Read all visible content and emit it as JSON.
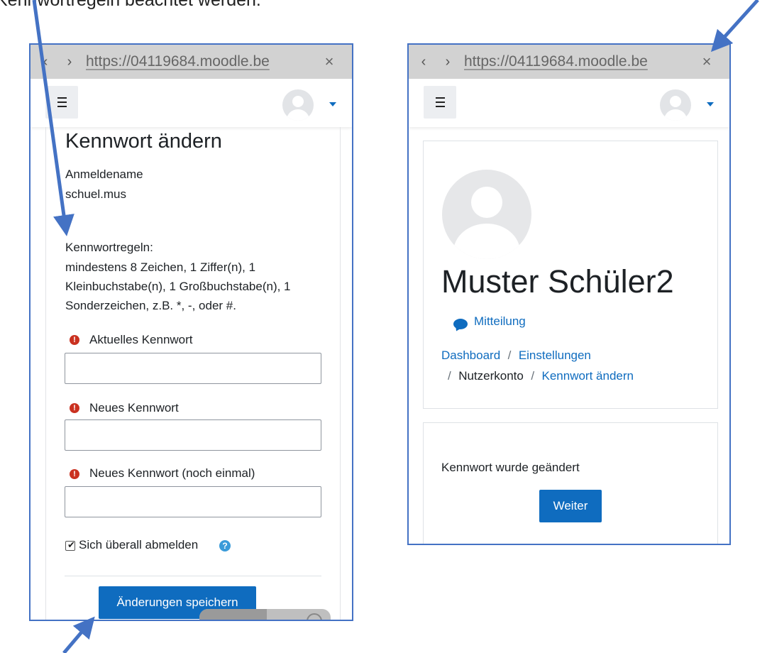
{
  "caption": "Kennwortregeln beachtet werden.",
  "browser": {
    "url": "https://04119684.moodle.be",
    "back_glyph": "‹",
    "forward_glyph": "›",
    "close_glyph": "×"
  },
  "password_form": {
    "title": "Kennwort ändern",
    "username_label": "Anmeldename",
    "username_value": "schuel.mus",
    "rules_heading": "Kennwortregeln:",
    "rules_text": "mindestens 8 Zeichen, 1 Ziffer(n), 1 Kleinbuchstabe(n), 1 Großbuchstabe(n), 1 Sonderzeichen, z.B. *, -, oder #.",
    "fields": [
      {
        "label": "Aktuelles Kennwort",
        "value": ""
      },
      {
        "label": "Neues Kennwort",
        "value": ""
      },
      {
        "label": "Neues Kennwort (noch einmal)",
        "value": ""
      }
    ],
    "logout_everywhere_label": "Sich überall abmelden",
    "logout_everywhere_checked": true,
    "help_glyph": "?",
    "save_label": "Änderungen speichern"
  },
  "profile": {
    "name": "Muster Schüler2",
    "message_label": "Mitteilung",
    "breadcrumb": [
      {
        "label": "Dashboard",
        "link": true
      },
      {
        "label": "Einstellungen",
        "link": true
      },
      {
        "label": "Nutzerkonto",
        "link": false
      },
      {
        "label": "Kennwort ändern",
        "link": true
      }
    ],
    "breadcrumb_separator": "/",
    "status_text": "Kennwort wurde geändert",
    "continue_label": "Weiter"
  },
  "colors": {
    "frame_border": "#4472c4",
    "moodle_primary": "#0f6cbf",
    "required_icon": "#ca3120",
    "annotation_arrow": "#4472c4"
  }
}
